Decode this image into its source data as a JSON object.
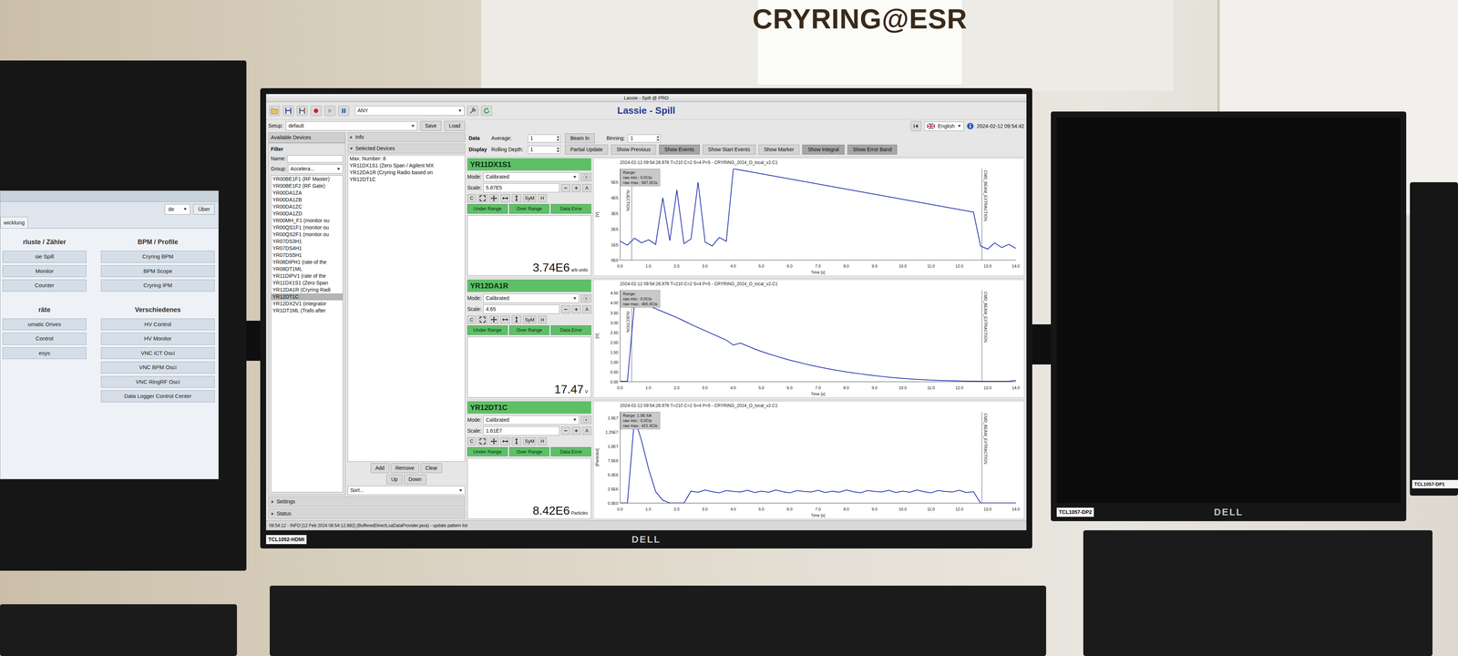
{
  "poster": {
    "title": "CRYRING@ESR"
  },
  "left_monitor": {
    "language": "de",
    "about": "Über",
    "tab": "wicklung",
    "sections": [
      {
        "title": "rluste / Zähler",
        "items": [
          "sie Spill",
          "Monitor",
          "Counter"
        ]
      },
      {
        "title": "BPM / Profile",
        "items": [
          "Cryring BPM",
          "BPM Scope",
          "Cryring IPM"
        ]
      },
      {
        "title": "räte",
        "items": [
          "umatic Drives",
          "Control",
          "esys"
        ]
      },
      {
        "title": "Verschiedenes",
        "items": [
          "HV Control",
          "HV Monitor",
          "VNC iCT Osci",
          "VNC BPM Osci",
          "VNC RingRF Osci",
          "Data Logger Control Center"
        ]
      }
    ]
  },
  "main_monitor": {
    "label": "TCL1052-HDMI",
    "brand": "DELL",
    "app": {
      "window_title": "Lassie - Spill @ PRO",
      "title": "Lassie - Spill",
      "pattern_combo": "ANY",
      "language": "English",
      "clock": "2024-02-12 09:54:42",
      "setup": {
        "label": "Setup:",
        "value": "default",
        "save": "Save",
        "load": "Load"
      },
      "available": {
        "tab": "Available Devices",
        "filter": "Filter",
        "name_label": "Name:",
        "group_label": "Group:",
        "group_value": "Accelera...",
        "items": [
          {
            "label": "YR00BE1F1 (RF Master)",
            "selected": false
          },
          {
            "label": "YR00BE1F2 (RF Gate)",
            "selected": false
          },
          {
            "label": "YR00DA1ZA",
            "selected": false
          },
          {
            "label": "YR00DA1ZB",
            "selected": false
          },
          {
            "label": "YR00DA1ZC",
            "selected": false
          },
          {
            "label": "YR00DA1ZD",
            "selected": false
          },
          {
            "label": "YR00MH_F1 (monitor ou",
            "selected": false
          },
          {
            "label": "YR00QS1F1 (monitor ou",
            "selected": false
          },
          {
            "label": "YR00QS2F1 (monitor ou",
            "selected": false
          },
          {
            "label": "YR07DS3H1",
            "selected": false
          },
          {
            "label": "YR07DS4H1",
            "selected": false
          },
          {
            "label": "YR07DS5H1",
            "selected": false
          },
          {
            "label": "YR08DIPH1 (rate of the",
            "selected": false
          },
          {
            "label": "YR08DT1ML",
            "selected": false
          },
          {
            "label": "YR11DIPV1 (rate of the",
            "selected": false
          },
          {
            "label": "YR11DX1S1 (Zero Span",
            "selected": false
          },
          {
            "label": "YR12DA1R (Cryring Radi",
            "selected": false
          },
          {
            "label": "YR12DT1C",
            "selected": true
          },
          {
            "label": "YR12DX2V1 (integrator",
            "selected": false
          },
          {
            "label": "YR1DT1ML (Trafo after",
            "selected": false
          }
        ]
      },
      "info": "Info",
      "selected": {
        "header": "Selected Devices",
        "max": "Max. Number: 8",
        "items": [
          "YR11DX1S1 (Zero Span / Agilent MX",
          "YR12DA1R (Cryring Radio based on",
          "YR12DT1C"
        ],
        "buttons": [
          "Add",
          "Remove",
          "Clear"
        ],
        "order_buttons": [
          "Up",
          "Down"
        ],
        "sort": "Sort..."
      },
      "collapsibles": [
        "Settings",
        "Status"
      ],
      "status_line": "08:54:12 - INFO [12 Feb 2024 08:54:12.882] (BufferedDirectLsaDataProvider.java) - update pattern list",
      "controls": {
        "data_label": "Data",
        "average_label": "Average:",
        "average": "1",
        "beam_in": "Beam In",
        "binning_label": "Binning:",
        "binning": "1",
        "display_label": "Display",
        "rolling_label": "Rolling Depth:",
        "rolling": "1",
        "toggles": [
          {
            "label": "Partial Update",
            "on": false
          },
          {
            "label": "Show Previous",
            "on": false
          },
          {
            "label": "Show Events",
            "on": true
          },
          {
            "label": "Show Start Events",
            "on": false
          },
          {
            "label": "Show Marker",
            "on": false
          },
          {
            "label": "Show Integral",
            "on": true
          },
          {
            "label": "Show Error Band",
            "on": true
          }
        ]
      },
      "panels": [
        {
          "device": "YR11DX1S1",
          "mode_label": "Mode:",
          "mode": "Calibrated",
          "scale_label": "Scale:",
          "scale": "5.87E5",
          "scale_button": "A",
          "tool_buttons": [
            "C",
            "SyM",
            "H"
          ],
          "flags": [
            "Under Range",
            "Over Range",
            "Data Error"
          ],
          "value": "3.74E6",
          "unit": "arb units",
          "chart": {
            "header": "2024-02-12 09:54:26.976  T=210 C=2 S=4 P=5 - CRYRING_2024_O_local_v2.C1",
            "range": [
              "Range:",
              "raw min.: 0.0Cts",
              "raw max.: 587.0Cts"
            ],
            "y_label": "[V]",
            "y_max": 587000,
            "y_ticks": [
              {
                "value": 0,
                "label": "0E0"
              },
              {
                "value": 100000,
                "label": "1E5"
              },
              {
                "value": 200000,
                "label": "2E5"
              },
              {
                "value": 300000,
                "label": "3E5"
              },
              {
                "value": 400000,
                "label": "4E5"
              },
              {
                "value": 500000,
                "label": "5E5"
              }
            ],
            "x_max": 14,
            "x_ticks": [
              "0.0",
              "1.0",
              "2.0",
              "3.0",
              "4.0",
              "5.0",
              "6.0",
              "7.0",
              "8.0",
              "9.0",
              "10.0",
              "11.0",
              "12.0",
              "13.0",
              "14.0"
            ],
            "x_label": "Time [s]",
            "series": [
              120000,
              95000,
              140000,
              110000,
              130000,
              100000,
              400000,
              125000,
              450000,
              105000,
              135000,
              500000,
              115000,
              90000,
              145000,
              120000,
              587000,
              578800,
              570600,
              562400,
              554200,
              546000,
              537800,
              529600,
              521400,
              513200,
              505000,
              496800,
              488600,
              480400,
              472200,
              464000,
              455800,
              447600,
              439400,
              431200,
              423000,
              414800,
              406600,
              398400,
              390200,
              382000,
              373800,
              365600,
              357400,
              349200,
              341000,
              332800,
              324600,
              316400,
              308200,
              90000,
              70000,
              110000,
              80000,
              100000,
              75000
            ],
            "events": [
              {
                "t": 0.4,
                "label": "INJECTION"
              },
              {
                "t": 12.8,
                "label": "CMD_BEAM_EXTRACTION"
              }
            ]
          }
        },
        {
          "device": "YR12DA1R",
          "mode_label": "Mode:",
          "mode": "Calibrated",
          "scale_label": "Scale:",
          "scale": "4.65",
          "scale_button": "A",
          "tool_buttons": [
            "C",
            "SyM",
            "H"
          ],
          "flags": [
            "Under Range",
            "Over Range",
            "Data Error"
          ],
          "value": "17.47",
          "unit": "V",
          "chart": {
            "header": "2024-02-12 09:54:26.976  T=210 C=2 S=4 P=5 - CRYRING_2024_O_local_v2.C1",
            "range": [
              "Range:",
              "raw min.: 0.0Cts",
              "raw max.: 465.0Cts"
            ],
            "y_label": "[V]",
            "y_max": 4.65,
            "y_ticks": [
              {
                "value": 0,
                "label": "0.00"
              },
              {
                "value": 0.5,
                "label": "0.50"
              },
              {
                "value": 1,
                "label": "1.00"
              },
              {
                "value": 1.5,
                "label": "1.50"
              },
              {
                "value": 2,
                "label": "2.00"
              },
              {
                "value": 2.5,
                "label": "2.50"
              },
              {
                "value": 3,
                "label": "3.00"
              },
              {
                "value": 3.5,
                "label": "3.50"
              },
              {
                "value": 4,
                "label": "4.00"
              },
              {
                "value": 4.5,
                "label": "4.50"
              }
            ],
            "x_max": 14,
            "x_ticks": [
              "0.0",
              "1.0",
              "2.0",
              "3.0",
              "4.0",
              "5.0",
              "6.0",
              "7.0",
              "8.0",
              "9.0",
              "10.0",
              "11.0",
              "12.0",
              "13.0",
              "14.0"
            ],
            "x_label": "Time [s]",
            "series": [
              0,
              0,
              4.0,
              3.95,
              3.85,
              3.7,
              3.55,
              3.4,
              3.25,
              3.08,
              2.9,
              2.74,
              2.58,
              2.42,
              2.26,
              2.1,
              1.85,
              1.95,
              1.8,
              1.65,
              1.52,
              1.4,
              1.29,
              1.18,
              1.08,
              0.99,
              0.9,
              0.82,
              0.74,
              0.67,
              0.6,
              0.54,
              0.48,
              0.43,
              0.38,
              0.33,
              0.29,
              0.25,
              0.21,
              0.18,
              0.15,
              0.12,
              0.1,
              0.08,
              0.06,
              0.05,
              0.04,
              0.03,
              0.02,
              0.01,
              0.01,
              0,
              0,
              0,
              0,
              0,
              0.05
            ],
            "events": [
              {
                "t": 0.4,
                "label": "INJECTION"
              },
              {
                "t": 12.8,
                "label": "CMD_BEAM_EXTRACTION"
              }
            ]
          }
        },
        {
          "device": "YR12DT1C",
          "mode_label": "Mode:",
          "mode": "Calibrated",
          "scale_label": "Scale:",
          "scale": "1.61E7",
          "scale_button": "A",
          "tool_buttons": [
            "C",
            "SyM",
            "H"
          ],
          "flags": [
            "Under Range",
            "Over Range",
            "Data Error"
          ],
          "value": "8.42E6",
          "unit": "Particles",
          "chart": {
            "header": "2024-02-12 09:54:26.976  T=210 C=2 S=4 P=5 - CRYRING_2024_O_local_v2.C1",
            "range": [
              "Range: 1.0E-5A",
              "raw min.: 0.0Cts",
              "raw max.: 421.0Cts"
            ],
            "y_label": "[Particles]",
            "y_max": 16100000,
            "y_ticks": [
              {
                "value": 0,
                "label": "0.0E0"
              },
              {
                "value": 2500000,
                "label": "2.5E6"
              },
              {
                "value": 5000000,
                "label": "5.0E6"
              },
              {
                "value": 7500000,
                "label": "7.5E6"
              },
              {
                "value": 10000000,
                "label": "1.0E7"
              },
              {
                "value": 12500000,
                "label": "1.25E7"
              },
              {
                "value": 15000000,
                "label": "1.5E7"
              }
            ],
            "x_max": 14,
            "x_ticks": [
              "0.0",
              "1.0",
              "2.0",
              "3.0",
              "4.0",
              "5.0",
              "6.0",
              "7.0",
              "8.0",
              "9.0",
              "10.0",
              "11.0",
              "12.0",
              "13.0",
              "14.0"
            ],
            "x_label": "Time [s]",
            "series": [
              0,
              0,
              15000000,
              11000000,
              6000000,
              2000000,
              500000,
              0,
              0,
              0,
              2100000,
              1900000,
              2300000,
              2000000,
              1800000,
              2200000,
              2050000,
              1950000,
              2250000,
              1850000,
              2100000,
              1900000,
              2300000,
              2000000,
              1800000,
              2200000,
              2050000,
              1950000,
              2250000,
              1850000,
              2100000,
              1900000,
              2300000,
              2000000,
              1800000,
              2200000,
              2050000,
              1950000,
              2250000,
              1850000,
              2100000,
              1900000,
              2300000,
              2000000,
              1800000,
              2200000,
              2050000,
              1950000,
              2250000,
              1850000,
              2000000,
              0,
              0,
              0,
              0,
              0,
              0
            ],
            "events": [
              {
                "t": 12.8,
                "label": "CMD_BEAM_EXTRACTION"
              }
            ]
          }
        }
      ]
    }
  },
  "right_monitor": {
    "label": "TCL1057-DP2",
    "brand": "DELL"
  },
  "far_right_monitor": {
    "label": "TCL1057-DP1"
  }
}
